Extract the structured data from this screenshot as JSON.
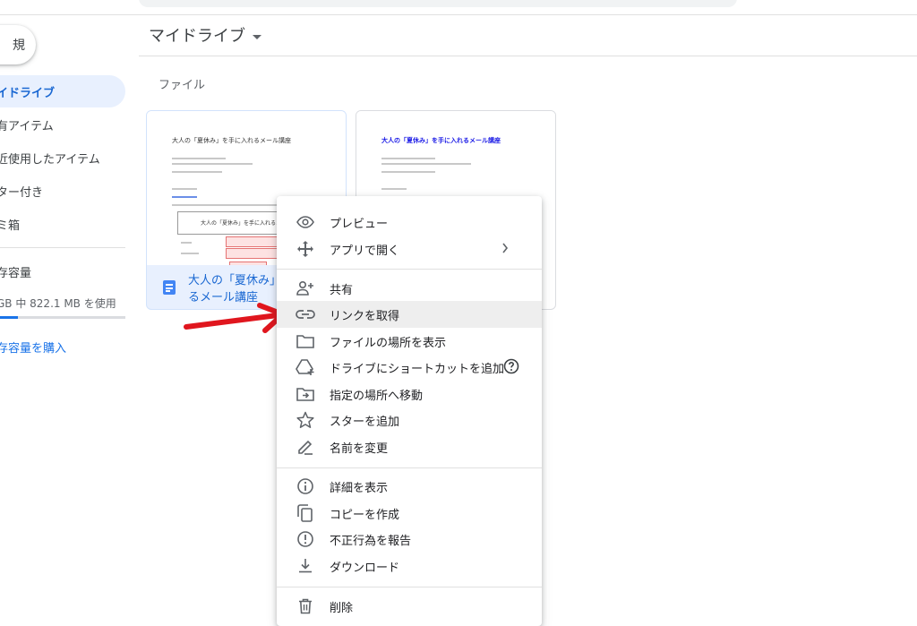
{
  "sidebar": {
    "new_label": "規",
    "items": [
      {
        "label": "イドライブ",
        "active": true
      },
      {
        "label": "有アイテム",
        "active": false
      },
      {
        "label": "近使用したアイテム",
        "active": false
      },
      {
        "label": "ター付き",
        "active": false
      },
      {
        "label": "ミ箱",
        "active": false
      }
    ],
    "storage_label": "存容量",
    "storage_usage": "GB 中 822.1 MB を使用",
    "buy_storage": "存容量を購入"
  },
  "header": {
    "title": "マイドライブ"
  },
  "files_section": {
    "label": "ファイル",
    "cards": [
      {
        "thumb_title": "大人の「夏休み」を手に入れるメール講座",
        "thumb_box_title": "大人の「夏休み」を手に入れるメール",
        "name": "大人の「夏休み」を手に入れるメール講座"
      },
      {
        "thumb_title": "大人の「夏休み」を手に入れるメール講座"
      }
    ]
  },
  "context_menu": {
    "items": [
      {
        "label": "プレビュー",
        "icon": "eye-icon"
      },
      {
        "label": "アプリで開く",
        "icon": "move-arrows-icon",
        "submenu": true
      },
      {
        "label": "共有",
        "icon": "add-person-icon"
      },
      {
        "label": "リンクを取得",
        "icon": "link-icon",
        "highlighted": true
      },
      {
        "label": "ファイルの場所を表示",
        "icon": "folder-icon"
      },
      {
        "label": "ドライブにショートカットを追加",
        "icon": "drive-shortcut-icon",
        "help": true
      },
      {
        "label": "指定の場所へ移動",
        "icon": "move-to-folder-icon"
      },
      {
        "label": "スターを追加",
        "icon": "star-icon"
      },
      {
        "label": "名前を変更",
        "icon": "pencil-icon"
      },
      {
        "label": "詳細を表示",
        "icon": "info-icon"
      },
      {
        "label": "コピーを作成",
        "icon": "copy-icon"
      },
      {
        "label": "不正行為を報告",
        "icon": "report-icon"
      },
      {
        "label": "ダウンロード",
        "icon": "download-icon"
      },
      {
        "label": "削除",
        "icon": "trash-icon"
      }
    ]
  },
  "colors": {
    "accent": "#1967d2",
    "selected_bg": "#e8f0fe",
    "annotation_arrow": "#e0161e"
  }
}
